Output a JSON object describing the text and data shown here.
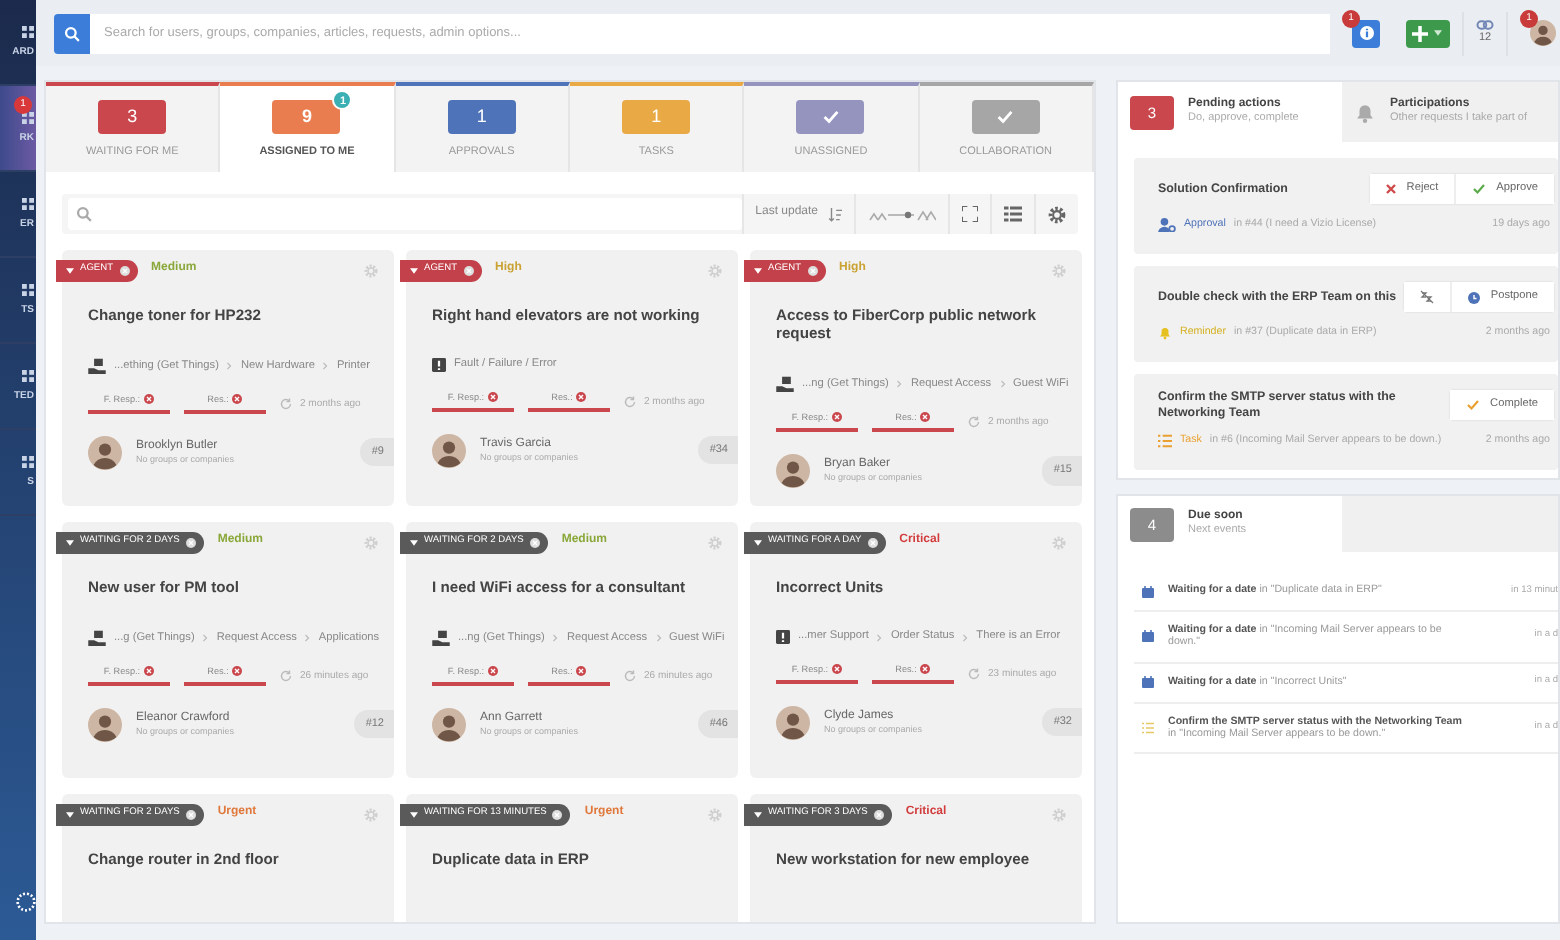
{
  "sidebar": {
    "items": [
      {
        "label": "ARD",
        "selected": false
      },
      {
        "label": "RK",
        "selected": true,
        "badge": "1"
      },
      {
        "label": "ER",
        "selected": false
      },
      {
        "label": "TS",
        "selected": false
      },
      {
        "label": "TED",
        "selected": false
      },
      {
        "label": "S",
        "selected": false
      }
    ]
  },
  "topbar": {
    "search_placeholder": "Search for users, groups, companies, articles, requests, admin options...",
    "notifications_badge": "1",
    "links_count": "12",
    "avatar_badge": "1"
  },
  "main": {
    "tabs": [
      {
        "kind": "count",
        "count": "3",
        "label": "WAITING FOR ME",
        "color": "#c9474d",
        "selected": false
      },
      {
        "kind": "count",
        "count": "9",
        "label": "ASSIGNED TO ME",
        "color": "#ea7d4f",
        "selected": true,
        "badge": "1"
      },
      {
        "kind": "count",
        "count": "1",
        "label": "APPROVALS",
        "color": "#4f73b8",
        "selected": false
      },
      {
        "kind": "count",
        "count": "1",
        "label": "TASKS",
        "color": "#e9aa45",
        "selected": false
      },
      {
        "kind": "check",
        "label": "UNASSIGNED",
        "color": "#9494bf",
        "selected": false
      },
      {
        "kind": "check",
        "label": "COLLABORATION",
        "color": "#a6a6a6",
        "selected": false
      }
    ],
    "toolbar": {
      "last_update_label": "Last update"
    },
    "cards": [
      {
        "tag": {
          "kind": "agent",
          "label": "AGENT"
        },
        "priority": {
          "label": "Medium",
          "color": "#8aa83a"
        },
        "title": "Change toner for HP232",
        "kind": "request",
        "path": [
          "...ething (Get Things)",
          "New Hardware",
          "Printer"
        ],
        "sla": [
          {
            "label": "F. Resp.:",
            "breached": true
          },
          {
            "label": "Res.:",
            "breached": true
          }
        ],
        "time": "2 months ago",
        "person": "Brooklyn Butler",
        "org": "No groups or companies",
        "id": "#9"
      },
      {
        "tag": {
          "kind": "agent",
          "label": "AGENT"
        },
        "priority": {
          "label": "High",
          "color": "#c9a232"
        },
        "title": "Right hand elevators are not working",
        "kind": "incident",
        "path": [
          "Fault / Failure / Error"
        ],
        "sla": [
          {
            "label": "F. Resp.:",
            "breached": true
          },
          {
            "label": "Res.:",
            "breached": true
          }
        ],
        "time": "2 months ago",
        "person": "Travis Garcia",
        "org": "No groups or companies",
        "id": "#34"
      },
      {
        "tag": {
          "kind": "agent",
          "label": "AGENT"
        },
        "priority": {
          "label": "High",
          "color": "#c9a232"
        },
        "title": "Access to FiberCorp public network request",
        "kind": "request",
        "path": [
          "...ng (Get Things)",
          "Request Access",
          "Guest WiFi"
        ],
        "sla": [
          {
            "label": "F. Resp.:",
            "breached": true
          },
          {
            "label": "Res.:",
            "breached": true
          }
        ],
        "time": "2 months ago",
        "person": "Bryan Baker",
        "org": "No groups or companies",
        "id": "#15"
      },
      {
        "tag": {
          "kind": "waiting",
          "label": "WAITING FOR 2 DAYS"
        },
        "priority": {
          "label": "Medium",
          "color": "#8aa83a"
        },
        "title": "New user for PM tool",
        "kind": "request",
        "path": [
          "...g (Get Things)",
          "Request Access",
          "Applications"
        ],
        "sla": [
          {
            "label": "F. Resp.:",
            "breached": true
          },
          {
            "label": "Res.:",
            "breached": true
          }
        ],
        "time": "26 minutes ago",
        "person": "Eleanor Crawford",
        "org": "No groups or companies",
        "id": "#12"
      },
      {
        "tag": {
          "kind": "waiting",
          "label": "WAITING FOR 2 DAYS"
        },
        "priority": {
          "label": "Medium",
          "color": "#8aa83a"
        },
        "title": "I need WiFi access for a consultant",
        "kind": "request",
        "path": [
          "...ng (Get Things)",
          "Request Access",
          "Guest WiFi"
        ],
        "sla": [
          {
            "label": "F. Resp.:",
            "breached": true
          },
          {
            "label": "Res.:",
            "breached": true
          }
        ],
        "time": "26 minutes ago",
        "person": "Ann Garrett",
        "org": "No groups or companies",
        "id": "#46"
      },
      {
        "tag": {
          "kind": "waiting",
          "label": "WAITING FOR A DAY"
        },
        "priority": {
          "label": "Critical",
          "color": "#d23c3c"
        },
        "title": "Incorrect Units",
        "kind": "incident",
        "path": [
          "...mer Support",
          "Order Status",
          "There is an Error"
        ],
        "sla": [
          {
            "label": "F. Resp.:",
            "breached": true
          },
          {
            "label": "Res.:",
            "breached": true
          }
        ],
        "time": "23 minutes ago",
        "person": "Clyde James",
        "org": "No groups or companies",
        "id": "#32"
      },
      {
        "tag": {
          "kind": "waiting",
          "label": "WAITING FOR 2 DAYS"
        },
        "priority": {
          "label": "Urgent",
          "color": "#e0783c"
        },
        "title": "Change router in 2nd floor"
      },
      {
        "tag": {
          "kind": "waiting",
          "label": "WAITING FOR 13 MINUTES"
        },
        "priority": {
          "label": "Urgent",
          "color": "#e0783c"
        },
        "title": "Duplicate data in ERP"
      },
      {
        "tag": {
          "kind": "waiting",
          "label": "WAITING FOR 3 DAYS"
        },
        "priority": {
          "label": "Critical",
          "color": "#d23c3c"
        },
        "title": "New workstation for new employee"
      }
    ]
  },
  "pending": {
    "tabs": [
      {
        "kind": "count",
        "count": "3",
        "title": "Pending actions",
        "subtitle": "Do, approve, complete",
        "selected": true
      },
      {
        "kind": "bell",
        "title": "Participations",
        "subtitle": "Other requests I take part of",
        "selected": false
      }
    ],
    "actions": [
      {
        "title": "Solution Confirmation",
        "buttons": [
          {
            "kind": "reject",
            "label": "Reject"
          },
          {
            "kind": "approve",
            "label": "Approve"
          }
        ],
        "kind": "approval",
        "type_label": "Approval",
        "detail": "in #44 (I need a Vizio License)",
        "time": "19 days ago"
      },
      {
        "title": "Double check with the ERP Team on this",
        "buttons": [
          {
            "kind": "snooze"
          },
          {
            "kind": "postpone",
            "label": "Postpone"
          }
        ],
        "kind": "reminder",
        "type_label": "Reminder",
        "detail": "in #37 (Duplicate data in ERP)",
        "time": "2 months ago"
      },
      {
        "title": "Confirm the SMTP server status with the Networking Team",
        "buttons": [
          {
            "kind": "complete",
            "label": "Complete"
          }
        ],
        "kind": "task",
        "type_label": "Task",
        "detail": "in #6 (Incoming Mail Server appears to be down.)",
        "time": "2 months ago"
      }
    ]
  },
  "due": {
    "tab": {
      "count": "4",
      "title": "Due soon",
      "subtitle": "Next events"
    },
    "events": [
      {
        "kind": "date",
        "text": "**Waiting for a date** in \"Duplicate data in ERP\"",
        "time": "in 13 minut"
      },
      {
        "kind": "date",
        "text": "**Waiting for a date** in \"Incoming Mail Server appears to be down.\"",
        "time": "in a d"
      },
      {
        "kind": "date",
        "text": "**Waiting for a date** in \"Incorrect Units\"",
        "time": "in a d"
      },
      {
        "kind": "task",
        "text": "**Confirm the SMTP server status with the Networking Team** in \"Incoming Mail Server appears to be down.\"",
        "time": "in a d"
      }
    ]
  }
}
